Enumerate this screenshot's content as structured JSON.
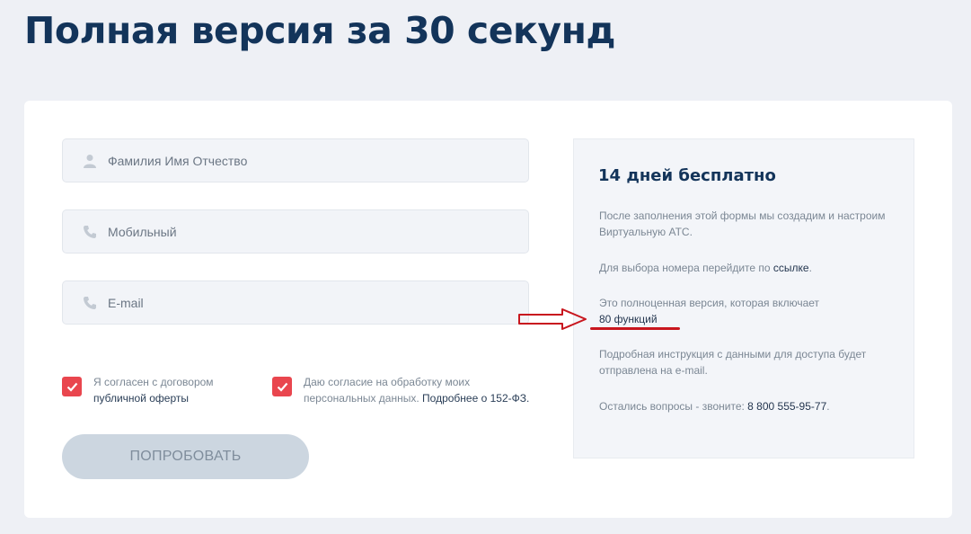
{
  "header": {
    "title": "Полная версия за 30 секунд"
  },
  "form": {
    "name_placeholder": "Фамилия Имя Отчество",
    "phone_placeholder": "Мобильный",
    "email_placeholder": "E-mail",
    "agree_offer_line1": "Я согласен с договором",
    "agree_offer_link": "публичной оферты",
    "agree_personal_line1": "Даю согласие на обработку моих",
    "agree_personal_line2": "персональных данных.",
    "agree_personal_link": "Подробнее о 152-ФЗ.",
    "submit_label": "ПОПРОБОВАТЬ"
  },
  "side": {
    "title": "14 дней бесплатно",
    "p1": "После заполнения этой формы мы создадим и настроим Виртуальную АТС.",
    "p2_text": "Для выбора номера перейдите по",
    "p2_link": "ссылке",
    "p3_text": "Это полноценная версия, которая включает",
    "p3_link": "80 функций",
    "p4": "Подробная инструкция с данными для доступа будет отправлена на e-mail.",
    "p5_text": "Остались вопросы - звоните:",
    "p5_phone": "8 800 555-95-77"
  },
  "colors": {
    "accent": "#e9464e",
    "title": "#13345a",
    "annotation": "#c8161e"
  },
  "icons": {
    "name": "user-icon",
    "phone": "phone-icon",
    "email": "phone-icon",
    "check": "checkmark-icon"
  }
}
